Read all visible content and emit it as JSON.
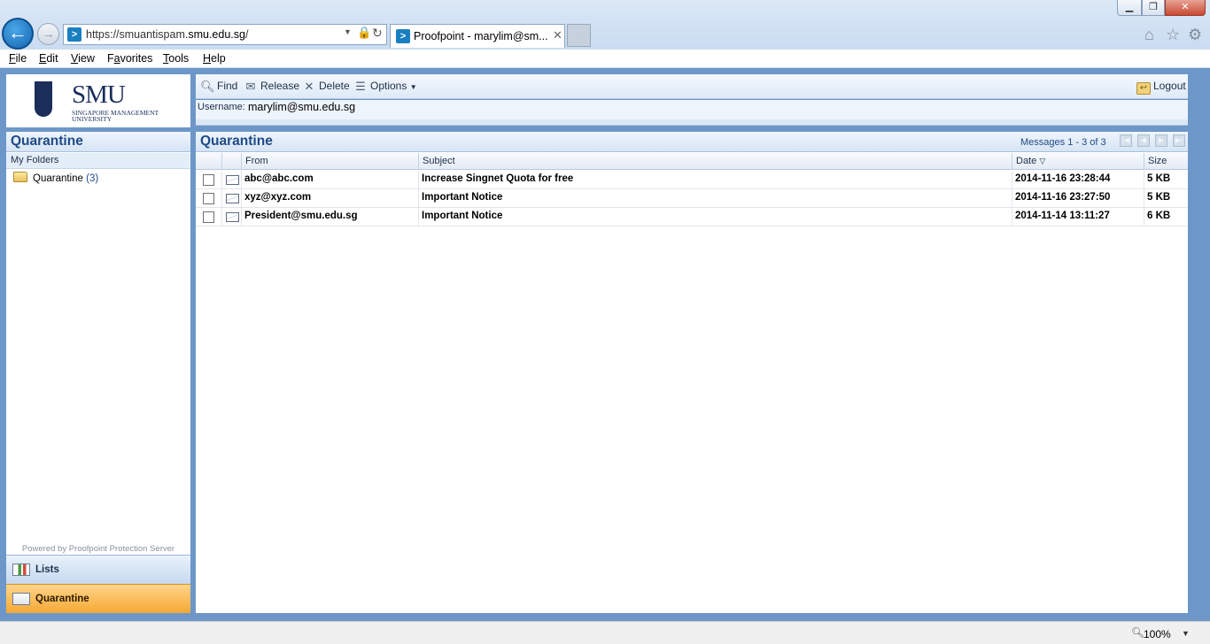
{
  "browser": {
    "url_prefix": "https://smuantispam.",
    "url_domain": "smu.edu.sg",
    "url_suffix": "/",
    "tab_title": "Proofpoint  - marylim@sm...",
    "window_controls": {
      "minimize": "▁",
      "maximize": "❐",
      "close": "✕"
    },
    "icons": [
      "back-icon",
      "forward-icon",
      "lock-icon",
      "refresh-icon",
      "home-icon",
      "star-icon",
      "gear-icon"
    ]
  },
  "menubar": {
    "items": [
      {
        "key": "F",
        "rest": "ile"
      },
      {
        "key": "E",
        "rest": "dit"
      },
      {
        "key": "V",
        "rest": "iew"
      },
      {
        "key": "F",
        "rest": "avorites",
        "pre": ""
      },
      {
        "key": "T",
        "rest": "ools"
      },
      {
        "key": "H",
        "rest": "elp"
      }
    ]
  },
  "logo": {
    "name": "SMU",
    "subtitle": "SINGAPORE MANAGEMENT UNIVERSITY"
  },
  "toolbar": {
    "find": "Find",
    "release": "Release",
    "delete": "Delete",
    "options": "Options",
    "logout": "Logout"
  },
  "user": {
    "label": "Username:",
    "value": "marylim@smu.edu.sg"
  },
  "left_pane": {
    "title": "Quarantine",
    "section": "My Folders",
    "folder_name": "Quarantine",
    "folder_count": "(3)",
    "powered_by": "Powered by Proofpoint Protection Server",
    "nav_lists": "Lists",
    "nav_quarantine": "Quarantine"
  },
  "right_pane": {
    "title": "Quarantine",
    "messages_count": "Messages 1 - 3 of 3",
    "columns": {
      "from": "From",
      "subject": "Subject",
      "date": "Date",
      "size": "Size"
    },
    "sort_indicator": "▽",
    "rows": [
      {
        "from": "abc@abc.com",
        "subject": "Increase Singnet Quota for free",
        "date": "2014-11-16 23:28:44",
        "size": "5 KB"
      },
      {
        "from": "xyz@xyz.com",
        "subject": "Important Notice",
        "date": "2014-11-16 23:27:50",
        "size": "5 KB"
      },
      {
        "from": "President@smu.edu.sg",
        "subject": "Important Notice",
        "date": "2014-11-14 13:11:27",
        "size": "6 KB"
      }
    ]
  },
  "statusbar": {
    "zoom": "100%"
  },
  "colors": {
    "frame": "#6d97c8",
    "title_text": "#1e4a86",
    "active_nav": "#f5a833"
  }
}
